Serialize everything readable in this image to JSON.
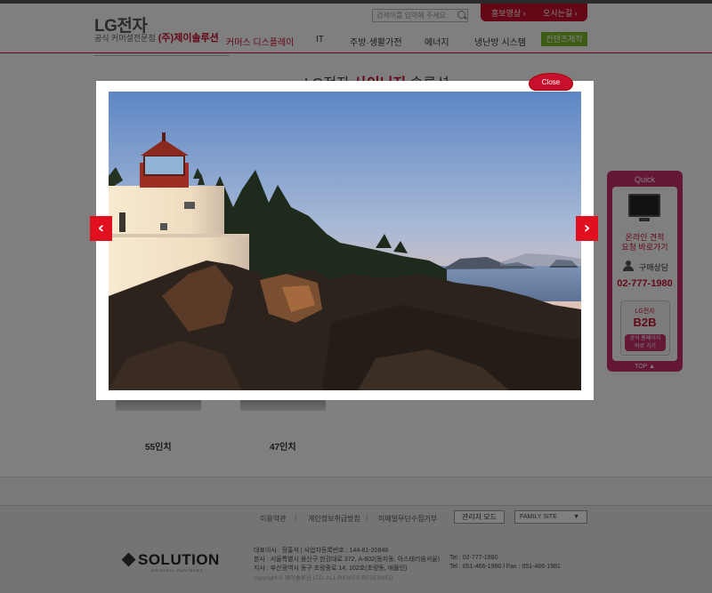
{
  "header": {
    "logo_main": "LG전자",
    "logo_sub": "공식 커머셜전문점",
    "logo_company": "(주)제이솔루션",
    "search_placeholder": "검색어를 입력해 주세요.",
    "util_links": [
      "홍보영상 ›",
      "오시는길 ›"
    ],
    "nav": [
      "커머스 디스플레이",
      "IT",
      "주방·생활가전",
      "에너지",
      "냉난방 시스템"
    ],
    "nav_button": "컨텐츠제작"
  },
  "banner": {
    "title_prefix": "LG전자",
    "title_highlight": "사이니지",
    "title_suffix": "솔루션"
  },
  "products": [
    {
      "label": "55인치"
    },
    {
      "label": "47인치"
    }
  ],
  "quick": {
    "title": "Quick",
    "online_quote": "온라인 견적\n요청 바로가기",
    "purchase_consult": "구매상담",
    "phone": "02-777-1980",
    "b2b_brand": "LG전자",
    "b2b_label": "B2B",
    "b2b_button": "공식 홈페이지\n바로 가기",
    "top": "TOP ▲"
  },
  "lightbox": {
    "close_label": "Close",
    "prev_glyph": "‹",
    "next_glyph": "›"
  },
  "footer": {
    "links": [
      "이용약관",
      "개인정보취급방침",
      "이메일무단수집거부"
    ],
    "admin_mode": "관리자 모드",
    "family_site": "FAMILY SITE",
    "family_arrow": "▼",
    "logo": "SOLUTION",
    "logo_sub": "ORIGINAL PARTNERS",
    "info_line1": "대표이사 : 장홍석   |   사업자등록번호 : 144-81-20848",
    "info_line2": "본사 : 서울특별시 용산구 한강대로 372, A-602(동자동, 아스테리움서울)",
    "info_line2_right": "Tel : 02-777-1980",
    "info_line3": "지사 : 부산광역시 동구 초량중로 14, 102호(초량동, 애플인)",
    "info_line3_right": "Tel : 051-466-1980 l Fax : 051-466-1981",
    "copyright": "copyright © 제이솔루션 LTD. ALL RIGHTS RESERVED"
  },
  "colors": {
    "brand_red": "#c8102e",
    "quick_pink": "#c8306b",
    "accent_green": "#7ab929"
  }
}
